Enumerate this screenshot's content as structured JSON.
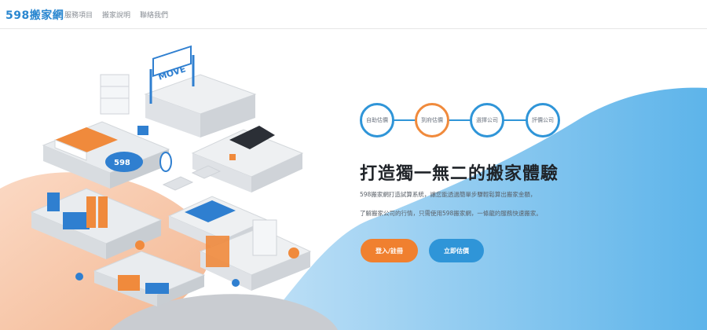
{
  "brand": {
    "name": "598搬家網"
  },
  "nav": {
    "items": [
      "服務項目",
      "搬家說明",
      "聯絡我們"
    ]
  },
  "illustration": {
    "sign_text": "MOVE",
    "badge_text": "598"
  },
  "steps": [
    {
      "label": "自助估價",
      "accent": "#2f95d8"
    },
    {
      "label": "到府估價",
      "accent": "#f08a3c"
    },
    {
      "label": "選擇公司",
      "accent": "#2f95d8"
    },
    {
      "label": "評價公司",
      "accent": "#2f95d8"
    }
  ],
  "hero": {
    "headline": "打造獨一無二的搬家體驗",
    "desc1": "598搬家網打造試算系統，讓您能透過簡單步驟輕鬆算出搬家金額，",
    "desc2": "了解搬家公司的行情，只需使用598搬家網，一條龍的服務快速搬家。",
    "login_button": "登入/註冊",
    "quote_button": "立即估價"
  },
  "colors": {
    "primary": "#2f95d8",
    "accent": "#f0802f",
    "brand": "#2a87d0"
  }
}
